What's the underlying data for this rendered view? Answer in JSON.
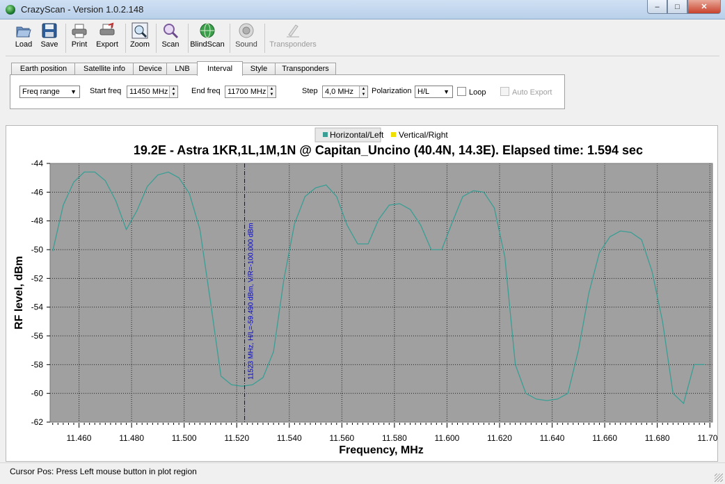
{
  "window": {
    "title": "CrazyScan - Version 1.0.2.148",
    "min": "–",
    "max": "□",
    "close": "✕"
  },
  "toolbar": [
    {
      "id": "load",
      "label": "Load",
      "icon": "folder-open-icon",
      "enabled": true
    },
    {
      "id": "save",
      "label": "Save",
      "icon": "floppy-disk-icon",
      "enabled": true
    },
    {
      "id": "print",
      "label": "Print",
      "icon": "printer-icon",
      "enabled": true
    },
    {
      "id": "export",
      "label": "Export",
      "icon": "export-printer-icon",
      "enabled": true
    },
    {
      "id": "zoom",
      "label": "Zoom",
      "icon": "zoom-icon",
      "enabled": true
    },
    {
      "id": "scan",
      "label": "Scan",
      "icon": "magnifier-icon",
      "enabled": true
    },
    {
      "id": "blindscan",
      "label": "BlindScan",
      "icon": "globe-icon",
      "enabled": true
    },
    {
      "id": "sound",
      "label": "Sound",
      "icon": "speaker-icon",
      "enabled": true
    },
    {
      "id": "transponders",
      "label": "Transponders",
      "icon": "pen-chart-icon",
      "enabled": false
    }
  ],
  "tabs": [
    "Earth position",
    "Satellite info",
    "Device",
    "LNB",
    "Interval",
    "Style",
    "Transponders"
  ],
  "active_tab": "Interval",
  "interval": {
    "mode": "Freq range",
    "start_label": "Start freq",
    "start_value": "11450 MHz",
    "end_label": "End freq",
    "end_value": "11700 MHz",
    "step_label": "Step",
    "step_value": "4,0 MHz",
    "polarization_label": "Polarization",
    "polarization_value": "H/L",
    "loop_label": "Loop",
    "loop_checked": false,
    "auto_export_label": "Auto Export",
    "auto_export_enabled": false
  },
  "status": {
    "text": "Cursor Pos: Press Left mouse button in plot region"
  },
  "colors": {
    "series_h": "#3a9e94",
    "series_v": "#f0e000",
    "plot_bg": "#a0a0a0",
    "cursor": "#0000cc"
  },
  "chart_data": {
    "type": "line",
    "title": "19.2E - Astra 1KR,1L,1M,1N @ Capitan_Uncino (40.4N, 14.3E). Elapsed time: 1.594 sec",
    "xlabel": "Frequency, MHz",
    "ylabel": "RF level, dBm",
    "xlim": [
      11449,
      11701
    ],
    "ylim": [
      -62,
      -44
    ],
    "xticks": [
      "11.460",
      "11.480",
      "11.500",
      "11.520",
      "11.540",
      "11.560",
      "11.580",
      "11.600",
      "11.620",
      "11.640",
      "11.660",
      "11.680",
      "11.700"
    ],
    "xtick_values": [
      11460,
      11480,
      11500,
      11520,
      11540,
      11560,
      11580,
      11600,
      11620,
      11640,
      11660,
      11680,
      11700
    ],
    "yticks": [
      -44,
      -46,
      -48,
      -50,
      -52,
      -54,
      -56,
      -58,
      -60,
      -62
    ],
    "grid": true,
    "legend_position": "top",
    "series": [
      {
        "name": "Horizontal/Left",
        "color": "#3a9e94",
        "x": [
          11450,
          11454,
          11458,
          11462,
          11466,
          11470,
          11474,
          11478,
          11482,
          11486,
          11490,
          11494,
          11498,
          11502,
          11506,
          11510,
          11514,
          11518,
          11522,
          11526,
          11530,
          11534,
          11538,
          11542,
          11546,
          11550,
          11554,
          11558,
          11562,
          11566,
          11570,
          11574,
          11578,
          11582,
          11586,
          11590,
          11594,
          11598,
          11602,
          11606,
          11610,
          11614,
          11618,
          11622,
          11626,
          11630,
          11634,
          11638,
          11642,
          11646,
          11650,
          11654,
          11658,
          11662,
          11666,
          11670,
          11674,
          11678,
          11682,
          11686,
          11690,
          11694,
          11698
        ],
        "y": [
          -50.1,
          -46.9,
          -45.3,
          -44.6,
          -44.6,
          -45.2,
          -46.6,
          -48.6,
          -47.3,
          -45.6,
          -44.8,
          -44.6,
          -45.0,
          -46.1,
          -48.6,
          -53.6,
          -58.8,
          -59.4,
          -59.5,
          -59.4,
          -58.9,
          -57.1,
          -52.0,
          -48.2,
          -46.3,
          -45.7,
          -45.5,
          -46.3,
          -48.3,
          -49.6,
          -49.6,
          -47.9,
          -46.9,
          -46.8,
          -47.2,
          -48.3,
          -50.0,
          -50.0,
          -48.1,
          -46.3,
          -45.9,
          -46.0,
          -47.1,
          -50.5,
          -58.0,
          -60.0,
          -60.4,
          -60.5,
          -60.4,
          -60.0,
          -57.0,
          -53.0,
          -50.2,
          -49.1,
          -48.7,
          -48.8,
          -49.3,
          -51.5,
          -55.0,
          -60.0,
          -60.7,
          -58.0,
          -58.0
        ],
        "draw_until": 11698
      },
      {
        "name": "Vertical/Right",
        "color": "#f0e000",
        "x": [],
        "y": []
      }
    ],
    "cursor": {
      "x": 11523,
      "label": "11523 MHz,  H/L=-59.490 dBm,  V/R=-100.000 dBm"
    }
  }
}
